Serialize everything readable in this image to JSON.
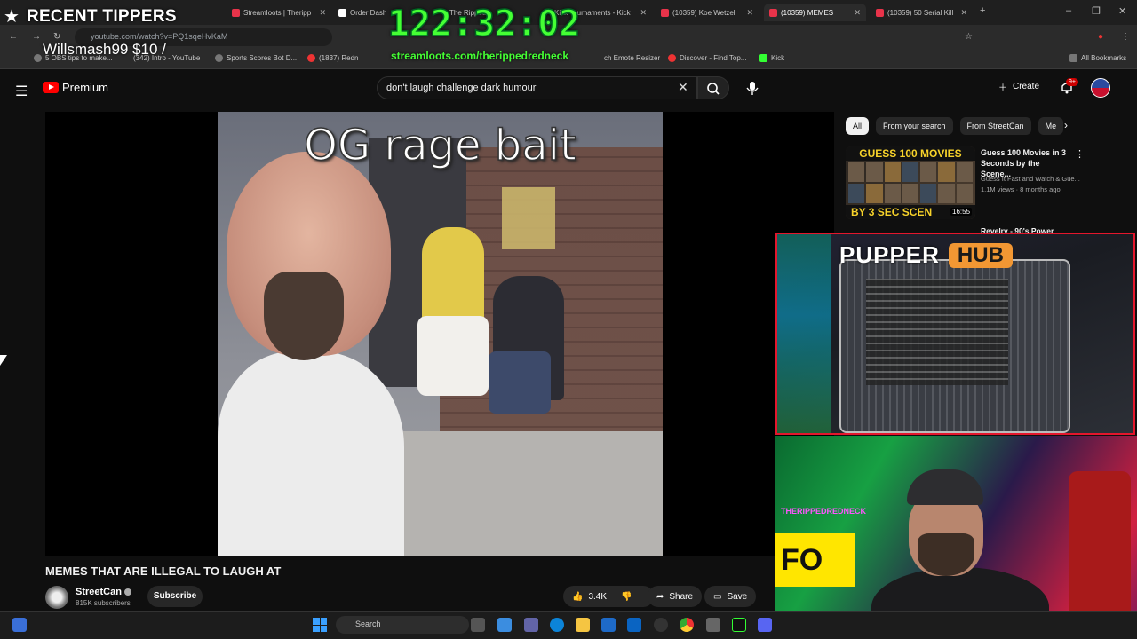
{
  "browser": {
    "tabs": [
      {
        "label": "Streamloots | Theripp"
      },
      {
        "label": "Order Dashb"
      },
      {
        "label": "The Ripped"
      },
      {
        "label": "Kick Tournaments - Kick"
      },
      {
        "label": "(10359) Koe Wetzel"
      },
      {
        "label": "(10359) MEMES",
        "active": true
      },
      {
        "label": "(10359) 50 Serial Kill"
      }
    ],
    "url": "youtube.com/watch?v=PQ1sqeHvKaM",
    "bookmarks": [
      {
        "label": "5 OBS tips to make..."
      },
      {
        "label": "(342) Intro - YouTube"
      },
      {
        "label": "Sports Scores Bot D..."
      },
      {
        "label": "(1837) Redn"
      },
      {
        "label": "ch Emote Resizer"
      },
      {
        "label": "Discover - Find Top..."
      },
      {
        "label": "Kick"
      }
    ],
    "all_bookmarks": "All Bookmarks"
  },
  "overlay": {
    "tippers_title": "RECENT TIPPERS",
    "tipper": "Willsmash99 $10 /",
    "timer": "122:32:02",
    "timer_sub": "streamloots.com/therippedredneck"
  },
  "youtube": {
    "brand": "Premium",
    "search_query": "don't laugh challenge dark humour",
    "create_label": "Create",
    "notification_badge": "9+"
  },
  "video": {
    "caption": "OG rage bait",
    "title": "MEMES THAT ARE ILLEGAL TO LAUGH AT",
    "channel": "StreetCan",
    "subscribers": "815K subscribers",
    "subscribe_label": "Subscribe",
    "likes": "3.4K",
    "share_label": "Share",
    "save_label": "Save"
  },
  "sidebar": {
    "chips": [
      {
        "label": "All",
        "active": true
      },
      {
        "label": "From your search"
      },
      {
        "label": "From StreetCan"
      },
      {
        "label": "Me"
      }
    ],
    "rec1": {
      "thumb_top": "GUESS 100 MOVIES",
      "thumb_bottom": "BY 3 SEC SCEN",
      "duration": "16:55",
      "title": "Guess 100 Movies in 3 Seconds by the Scene...",
      "channel": "Guess It Fast and Watch & Gue...",
      "meta": "1.1M views · 8 months ago"
    },
    "rec2": {
      "title": "Revelry - 90's Power"
    }
  },
  "pupper": {
    "word1": "PUPPER",
    "word2": "HUB"
  },
  "webcam": {
    "neon_text": "THERIPPEDREDNECK",
    "sign_text": "FO"
  },
  "taskbar": {
    "search_label": "Search"
  },
  "colors": {
    "yt_red": "#ff0000",
    "timer_green": "#45ff34",
    "pupper_orange": "#f29733",
    "overlay_red": "#e4162c"
  }
}
